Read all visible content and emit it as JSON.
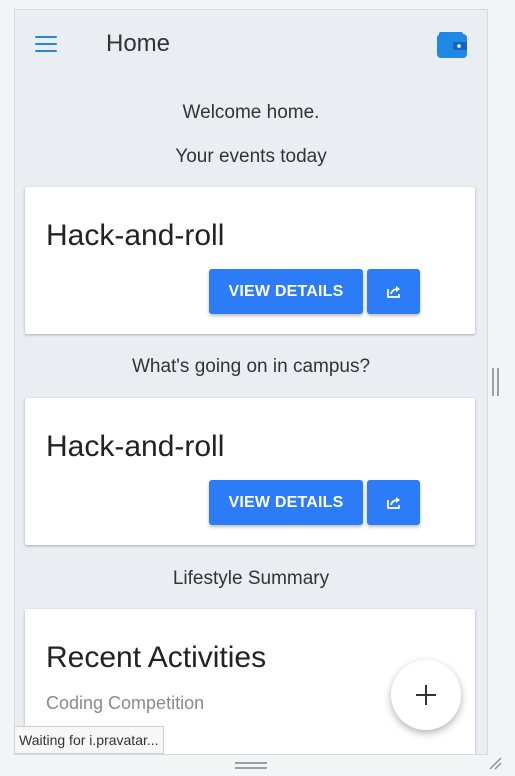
{
  "header": {
    "title": "Home",
    "menu_icon": "hamburger-menu-icon",
    "wallet_icon": "wallet-icon",
    "accent": "#1e88e5"
  },
  "main": {
    "welcome": "Welcome home.",
    "events_heading": "Your events today",
    "campus_heading": "What's going on in campus?",
    "lifestyle_heading": "Lifestyle Summary"
  },
  "event_cards": [
    {
      "title": "Hack-and-roll",
      "details_label": "VIEW DETAILS",
      "share_icon": "share-icon"
    },
    {
      "title": "Hack-and-roll",
      "details_label": "VIEW DETAILS",
      "share_icon": "share-icon"
    }
  ],
  "recent": {
    "title": "Recent Activities",
    "item": "Coding Competition"
  },
  "fab": {
    "label": "+"
  },
  "status": {
    "text": "Waiting for i.pravatar..."
  },
  "colors": {
    "button": "#2b7cf6",
    "background": "#eaedf1"
  }
}
